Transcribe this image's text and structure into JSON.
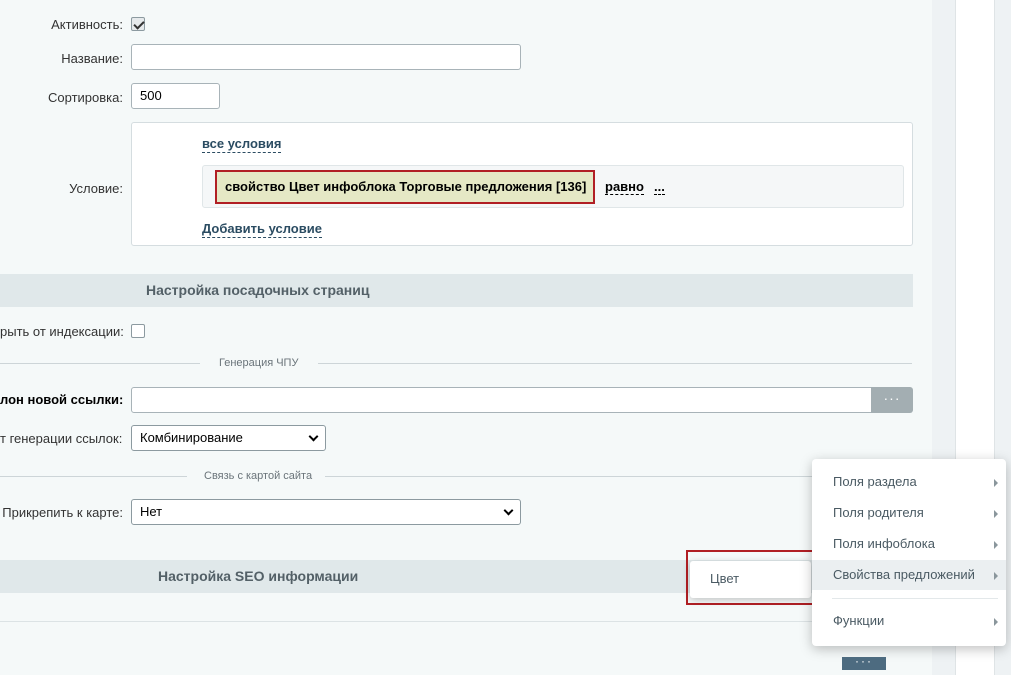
{
  "form": {
    "activity_label": "Активность:",
    "name_label": "Название:",
    "name_value": "",
    "sort_label": "Сортировка:",
    "sort_value": "500",
    "condition_label": "Условие:",
    "all_conditions_link": "все условия",
    "condition_chip": "свойство Цвет инфоблока Торговые предложения [136]",
    "condition_operator": "равно",
    "condition_value": "...",
    "add_condition_link": "Добавить условие"
  },
  "landing": {
    "section_title": "Настройка посадочных страниц",
    "hide_index_label": "рыть от индексации:",
    "chpu_divider": "Генерация ЧПУ",
    "template_label": "лон новой ссылки:",
    "template_value": "",
    "template_button": "···",
    "generation_label": "т генерации ссылок:",
    "generation_value": "Комбинирование",
    "sitemap_divider": "Связь с картой сайта",
    "attach_label": "Прикрепить к карте:",
    "attach_value": "Нет"
  },
  "seo": {
    "section_title": "Настройка SEO информации"
  },
  "menu": {
    "items": [
      {
        "label": "Поля раздела"
      },
      {
        "label": "Поля родителя"
      },
      {
        "label": "Поля инфоблока"
      },
      {
        "label": "Свойства предложений"
      },
      {
        "label": "Функции"
      }
    ],
    "submenu_item": "Цвет",
    "bottom_button": "···"
  }
}
